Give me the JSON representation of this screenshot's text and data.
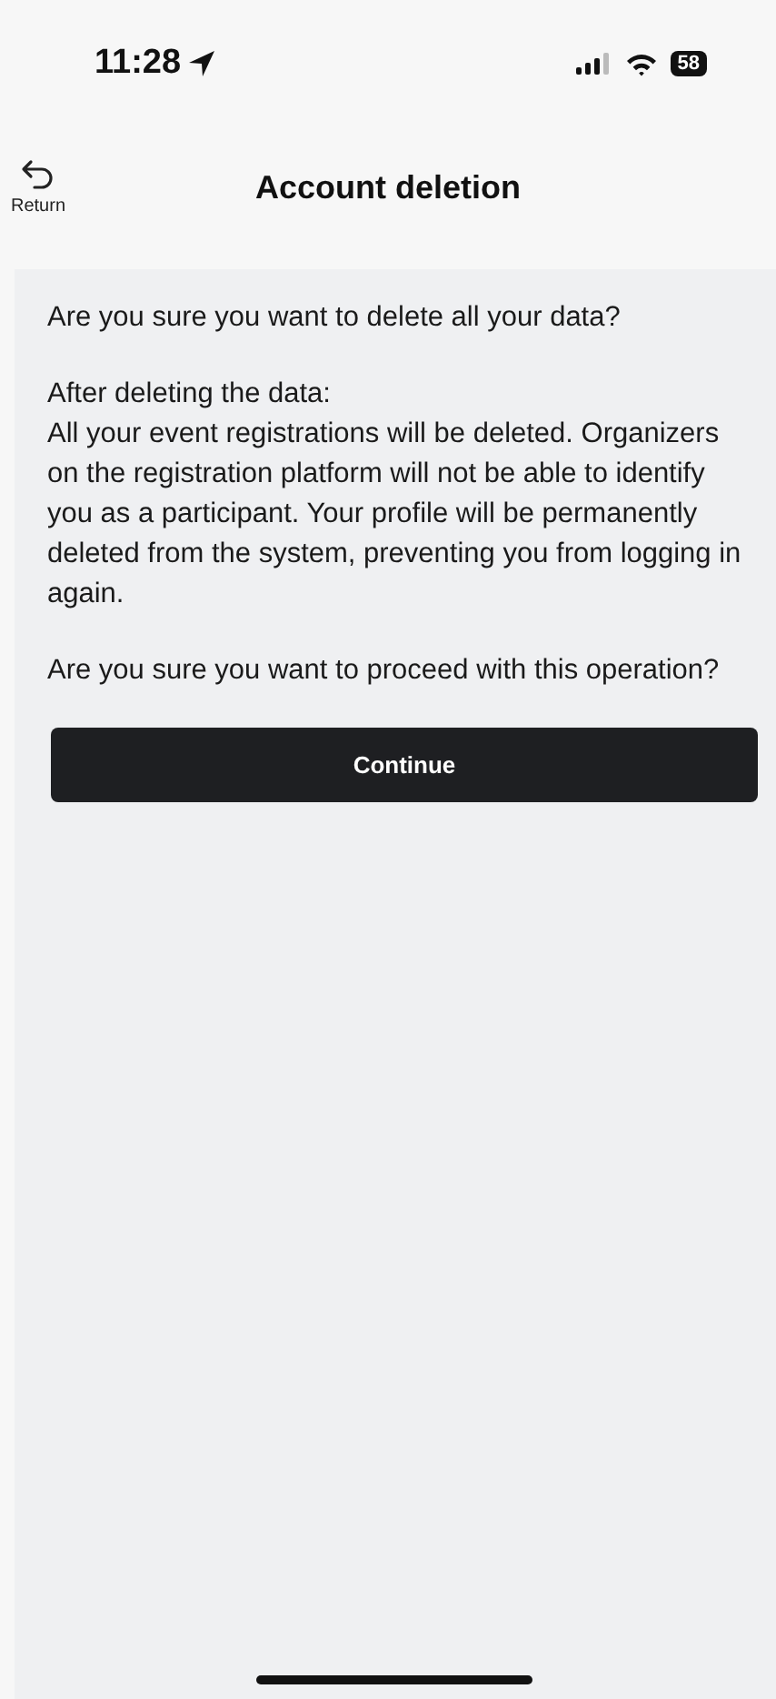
{
  "status_bar": {
    "time": "11:28",
    "battery": "58"
  },
  "header": {
    "back_label": "Return",
    "title": "Account deletion"
  },
  "content": {
    "question": "Are you sure you want to delete all your data?",
    "details_heading": "After deleting the data:",
    "details": "All your event registrations will be deleted. Organizers on the registration platform will not be able to identify you as a participant. Your profile will be permanently deleted from the system, preventing you from logging in again.",
    "confirm_question": "Are you sure you want to proceed with this operation?"
  },
  "button": {
    "label": "Continue"
  }
}
